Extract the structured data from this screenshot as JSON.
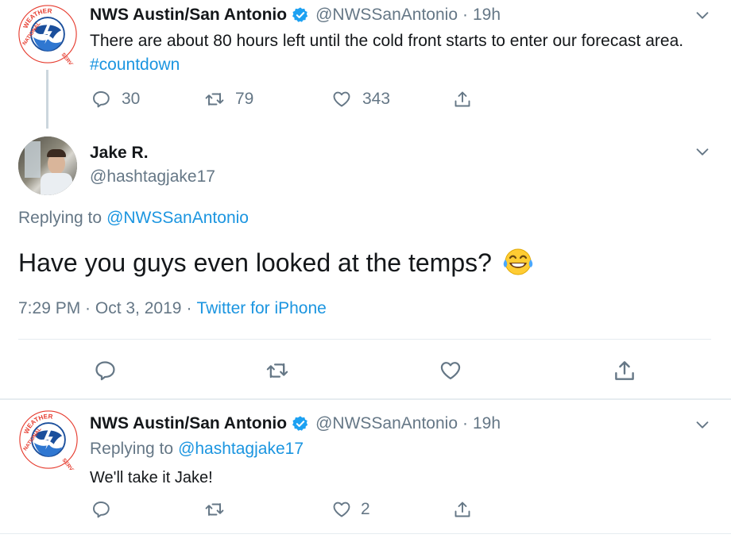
{
  "tweet1": {
    "name": "NWS Austin/San Antonio",
    "handle": "@NWSSanAntonio",
    "separator": "·",
    "time": "19h",
    "text_before": "There are about 80 hours left until the cold front starts to enter our forecast area.",
    "hashtag": "#countdown",
    "replies": "30",
    "retweets": "79",
    "likes": "343"
  },
  "main_tweet": {
    "name": "Jake R.",
    "handle": "@hashtagjake17",
    "replying_prefix": "Replying to",
    "replying_to": "@NWSSanAntonio",
    "text": "Have you guys even looked at the temps?",
    "emoji": "😂",
    "timestamp": "7:29 PM · Oct 3, 2019",
    "separator": "·",
    "source": "Twitter for iPhone"
  },
  "tweet3": {
    "name": "NWS Austin/San Antonio",
    "handle": "@NWSSanAntonio",
    "separator": "·",
    "time": "19h",
    "replying_prefix": "Replying to",
    "replying_to": "@hashtagjake17",
    "text": "We'll take it Jake!",
    "likes": "2"
  },
  "avatar_badge_text": "NATIONAL WEATHER SERVICE",
  "colors": {
    "link": "#1b95e0",
    "muted": "#657786",
    "text": "#14171a",
    "verified": "#1da1f2",
    "divider": "#e6ecf0"
  },
  "icons": [
    "reply-icon",
    "retweet-icon",
    "like-icon",
    "share-icon",
    "chevron-down-icon",
    "verified-badge-icon"
  ]
}
